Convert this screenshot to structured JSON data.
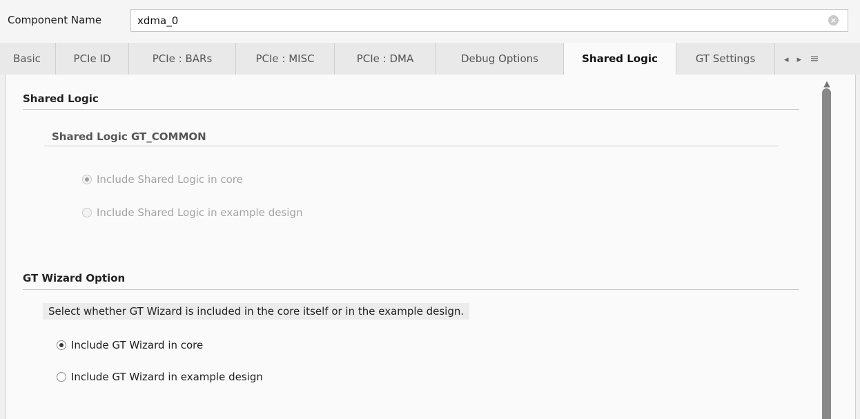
{
  "component": {
    "label": "Component Name",
    "value": "xdma_0"
  },
  "tabs": [
    {
      "label": "Basic",
      "active": false
    },
    {
      "label": "PCIe ID",
      "active": false
    },
    {
      "label": "PCIe : BARs",
      "active": false
    },
    {
      "label": "PCIe : MISC",
      "active": false
    },
    {
      "label": "PCIe : DMA",
      "active": false
    },
    {
      "label": "Debug Options",
      "active": false
    },
    {
      "label": "Shared Logic",
      "active": true
    },
    {
      "label": "GT Settings",
      "active": false
    }
  ],
  "tab_nav": {
    "prev": "◂",
    "next": "▸",
    "menu": "≡"
  },
  "shared_logic": {
    "title": "Shared Logic",
    "sub_title": "Shared Logic GT_COMMON",
    "options": [
      {
        "label": "Include Shared Logic in core",
        "checked": true,
        "enabled": false
      },
      {
        "label": "Include Shared Logic in example design",
        "checked": false,
        "enabled": false
      }
    ]
  },
  "gt_wizard": {
    "title": "GT Wizard Option",
    "description": "Select whether GT Wizard is included in the core itself or in the example design.",
    "options": [
      {
        "label": "Include GT Wizard in core",
        "checked": true,
        "enabled": true
      },
      {
        "label": "Include GT Wizard in example design",
        "checked": false,
        "enabled": true
      }
    ]
  },
  "icons": {
    "clear": "clear-icon",
    "scroll_up": "scroll-up-icon"
  }
}
